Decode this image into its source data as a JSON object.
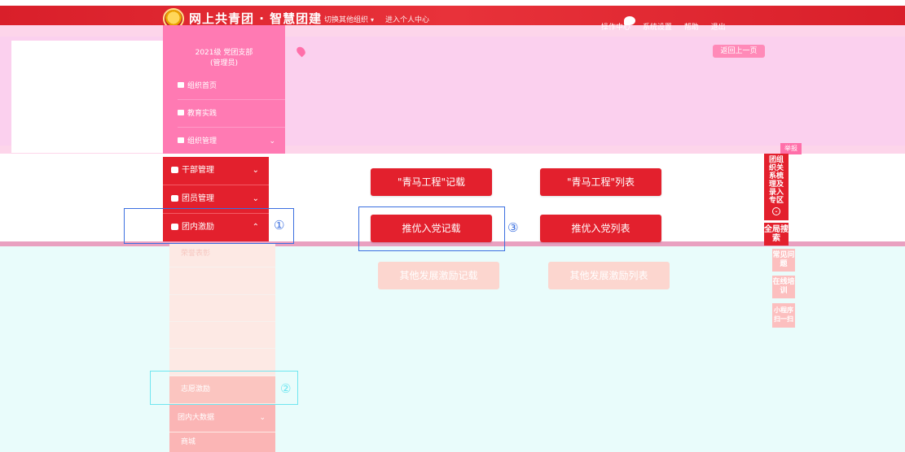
{
  "header": {
    "site_title": "网上共青团 · 智慧团建",
    "nav": [
      {
        "label": "切换其他组织"
      },
      {
        "label": "进入个人中心"
      }
    ],
    "right_links": [
      {
        "label": "操作中心"
      },
      {
        "label": "系统设置"
      },
      {
        "label": "帮助"
      },
      {
        "label": "退出"
      }
    ]
  },
  "org_panel": {
    "line1": "2021级 党团支部",
    "line2": "(管理员)"
  },
  "upper_menu": [
    {
      "label": "组织首页"
    },
    {
      "label": "教育实践"
    },
    {
      "label": "组织管理"
    }
  ],
  "back_button": "返回上一页",
  "menu": [
    {
      "label": "干部管理"
    },
    {
      "label": "团员管理"
    },
    {
      "label": "团内激励"
    }
  ],
  "submenu": {
    "first": "荣誉表彰",
    "active": "志愿激励",
    "stats": "团内大数据",
    "bottom": "商城"
  },
  "actions": {
    "qingma_record": "\"青马工程\"记载",
    "qingma_list": "\"青马工程\"列表",
    "tuiyou_record": "推优入党记载",
    "tuiyou_list": "推优入党列表",
    "other_record": "其他发展激励记载",
    "other_list": "其他发展激励列表"
  },
  "annotations": {
    "n1": "①",
    "n2": "②",
    "n3": "③"
  },
  "right_sidebar": {
    "tag": "举报",
    "system_entry": "团组织关系梳理及录入专区",
    "search": "全局搜索",
    "faq": "常见问题",
    "online": "在线培训",
    "helper": "小程序扫一扫"
  },
  "colors": {
    "brand_red": "#e3202d",
    "annotation_blue": "#3b6fe0",
    "annotation_cyan": "#6fe6f0"
  }
}
